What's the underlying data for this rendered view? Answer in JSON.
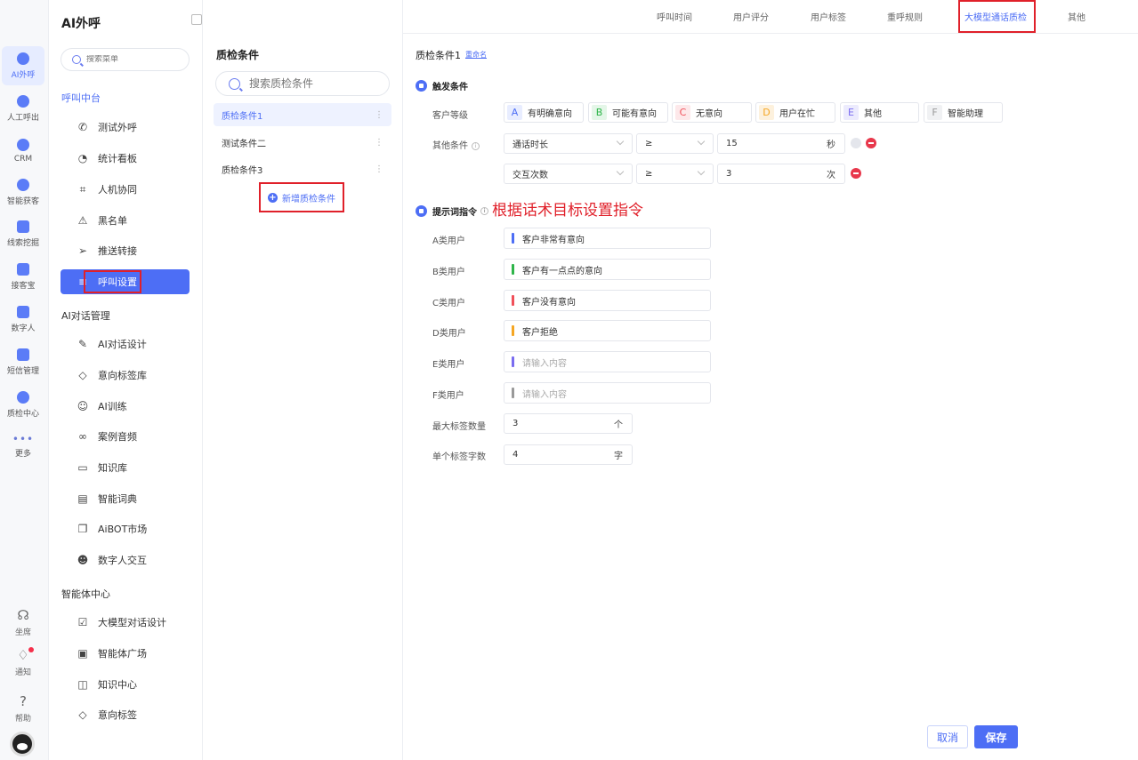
{
  "rail": {
    "items": [
      {
        "label": "AI外呼",
        "icon": "robot-icon"
      },
      {
        "label": "人工呼出",
        "icon": "phone-out-icon"
      },
      {
        "label": "CRM",
        "icon": "crm-icon"
      },
      {
        "label": "智能获客",
        "icon": "target-icon"
      },
      {
        "label": "线索挖掘",
        "icon": "mining-icon"
      },
      {
        "label": "接客宝",
        "icon": "reception-icon"
      },
      {
        "label": "数字人",
        "icon": "digital-human-icon"
      },
      {
        "label": "短信管理",
        "icon": "sms-icon"
      },
      {
        "label": "质检中心",
        "icon": "quality-icon"
      },
      {
        "label": "更多",
        "icon": "more-icon"
      }
    ],
    "bottom": [
      {
        "label": "坐席",
        "icon": "headset-icon"
      },
      {
        "label": "通知",
        "icon": "bell-icon"
      },
      {
        "label": "帮助",
        "icon": "help-icon"
      }
    ]
  },
  "nav": {
    "title": "AI外呼",
    "search_placeholder": "搜索菜单",
    "groups": [
      {
        "title": "呼叫中台",
        "items": [
          "测试外呼",
          "统计看板",
          "人机协同",
          "黑名单",
          "推送转接",
          "呼叫设置"
        ]
      },
      {
        "title": "AI对话管理",
        "items": [
          "AI对话设计",
          "意向标签库",
          "AI训练",
          "案例音频",
          "知识库",
          "智能词典",
          "AiBOT市场",
          "数字人交互"
        ]
      },
      {
        "title": "智能体中心",
        "items": [
          "大模型对话设计",
          "智能体广场",
          "知识中心",
          "意向标签"
        ]
      }
    ]
  },
  "conditions": {
    "title": "质检条件",
    "search_placeholder": "搜索质检条件",
    "items": [
      "质检条件1",
      "测试条件二",
      "质检条件3"
    ],
    "add_label": "新增质检条件"
  },
  "tabs": [
    "呼叫时间",
    "用户评分",
    "用户标签",
    "重呼规则",
    "大模型通话质检",
    "其他"
  ],
  "main": {
    "title": "质检条件1",
    "rename": "重命名",
    "trigger_title": "触发条件",
    "grade_label": "客户等级",
    "grades": [
      {
        "letter": "A",
        "text": "有明确意向",
        "color": "#4d6ef5",
        "bg": "#e8edff"
      },
      {
        "letter": "B",
        "text": "可能有意向",
        "color": "#2fb54a",
        "bg": "#e4f6e8"
      },
      {
        "letter": "C",
        "text": "无意向",
        "color": "#f0505a",
        "bg": "#fde8ea"
      },
      {
        "letter": "D",
        "text": "用户在忙",
        "color": "#f5a623",
        "bg": "#fdf1dd"
      },
      {
        "letter": "E",
        "text": "其他",
        "color": "#7a6cf0",
        "bg": "#ecebfd"
      },
      {
        "letter": "F",
        "text": "智能助理",
        "color": "#999999",
        "bg": "#f0f1f3"
      }
    ],
    "other_label": "其他条件",
    "rules": [
      {
        "field": "通话时长",
        "op": "≥",
        "value": "15",
        "unit": "秒"
      },
      {
        "field": "交互次数",
        "op": "≥",
        "value": "3",
        "unit": "次"
      }
    ],
    "prompt_title": "提示词指令",
    "annotation": "根据话术目标设置指令",
    "prompts": [
      {
        "label": "A类用户",
        "value": "客户非常有意向",
        "placeholder": "",
        "color": "#4d6ef5"
      },
      {
        "label": "B类用户",
        "value": "客户有一点点的意向",
        "placeholder": "",
        "color": "#2fb54a"
      },
      {
        "label": "C类用户",
        "value": "客户没有意向",
        "placeholder": "",
        "color": "#f0505a"
      },
      {
        "label": "D类用户",
        "value": "客户拒绝",
        "placeholder": "",
        "color": "#f5a623"
      },
      {
        "label": "E类用户",
        "value": "",
        "placeholder": "请输入内容",
        "color": "#7a6cf0"
      },
      {
        "label": "F类用户",
        "value": "",
        "placeholder": "请输入内容",
        "color": "#999999"
      }
    ],
    "max_tags_label": "最大标签数量",
    "max_tags_value": "3",
    "max_tags_unit": "个",
    "tag_chars_label": "单个标签字数",
    "tag_chars_value": "4",
    "tag_chars_unit": "字"
  },
  "buttons": {
    "cancel": "取消",
    "save": "保存"
  },
  "colors": {
    "accent": "#4d6ef5",
    "highlight_box": "#e0202a"
  }
}
